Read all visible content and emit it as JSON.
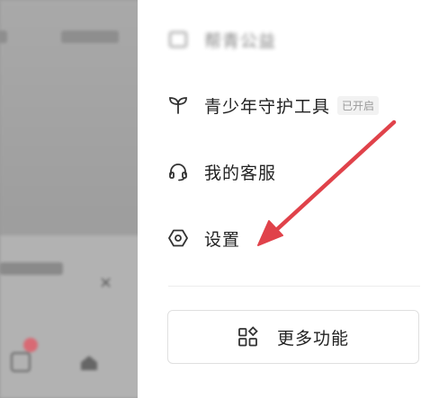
{
  "drawer": {
    "items": [
      {
        "label": "帮青公益",
        "icon": "heart-box-icon"
      },
      {
        "label": "青少年守护工具",
        "icon": "sprout-icon",
        "badge": "已开启"
      },
      {
        "label": "我的客服",
        "icon": "headset-icon"
      },
      {
        "label": "设置",
        "icon": "hexagon-gear-icon"
      }
    ],
    "more_button": {
      "label": "更多功能",
      "icon": "apps-grid-icon"
    }
  },
  "background": {
    "close_glyph": "×"
  },
  "colors": {
    "arrow": "#e0424a",
    "drawer_bg": "#ffffff",
    "badge_bg": "#f2f2f2"
  }
}
